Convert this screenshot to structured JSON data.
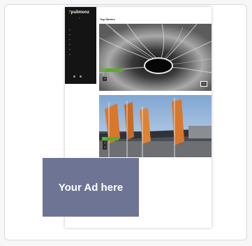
{
  "site": {
    "logo_prefix": "?",
    "logo_name": "pullmonz",
    "logo_sub": "?"
  },
  "sidebar": {
    "nav": [
      "?",
      "?",
      "?",
      "?",
      "?",
      "?"
    ]
  },
  "main": {
    "section_title": "Top Stories",
    "stories": [
      {
        "tag": "?",
        "headline_1": "?",
        "headline_2": "?",
        "more": "?"
      },
      {
        "tag": "?",
        "headline_1": "?",
        "headline_2": "?"
      }
    ]
  },
  "ad": {
    "text": "Your Ad here"
  },
  "colors": {
    "accent": "#5aaa2d",
    "ad_background": "#6e7493",
    "sidebar": "#141414"
  }
}
